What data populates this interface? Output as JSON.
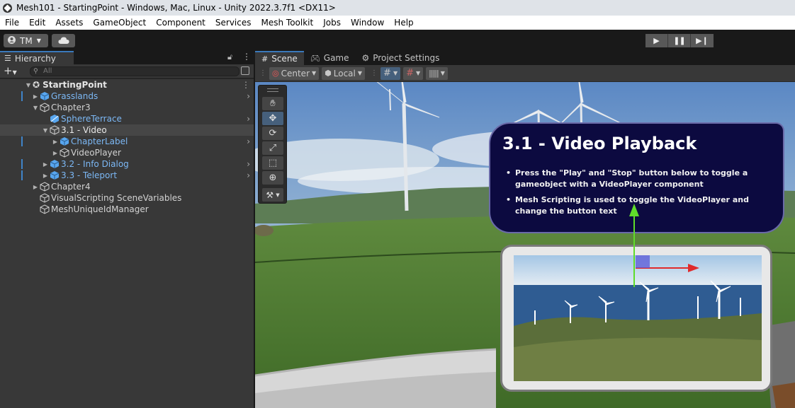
{
  "window": {
    "title": "Mesh101 - StartingPoint - Windows, Mac, Linux - Unity 2022.3.7f1 <DX11>"
  },
  "menu": [
    "File",
    "Edit",
    "Assets",
    "GameObject",
    "Component",
    "Services",
    "Mesh Toolkit",
    "Jobs",
    "Window",
    "Help"
  ],
  "toolbar": {
    "account": "TM",
    "play_icons": [
      "play-icon",
      "pause-icon",
      "step-icon"
    ]
  },
  "hierarchy": {
    "tab_label": "Hierarchy",
    "search_placeholder": "All",
    "rows": [
      {
        "label": "StartingPoint",
        "level": 0,
        "expanded": true,
        "scene": true
      },
      {
        "label": "Grasslands",
        "level": 1,
        "prefab": true,
        "collapsed": true
      },
      {
        "label": "Chapter3",
        "level": 1,
        "expanded": true
      },
      {
        "label": "SphereTerrace",
        "level": 2,
        "prefab": true
      },
      {
        "label": "3.1 - Video",
        "level": 2,
        "expanded": true,
        "selected": true
      },
      {
        "label": "ChapterLabel",
        "level": 3,
        "prefab": true,
        "collapsed": true
      },
      {
        "label": "VideoPlayer",
        "level": 3,
        "collapsed": true
      },
      {
        "label": "3.2 - Info Dialog",
        "level": 2,
        "prefab": true,
        "collapsed": true
      },
      {
        "label": "3.3 - Teleport",
        "level": 2,
        "prefab": true,
        "collapsed": true
      },
      {
        "label": "Chapter4",
        "level": 1,
        "collapsed": true
      },
      {
        "label": "VisualScripting SceneVariables",
        "level": 1
      },
      {
        "label": "MeshUniqueIdManager",
        "level": 1
      }
    ]
  },
  "scene_tabs": {
    "scene": "Scene",
    "game": "Game",
    "project_settings": "Project Settings"
  },
  "scene_tools": {
    "pivot": "Center",
    "space": "Local"
  },
  "info_panel": {
    "title": "3.1 - Video Playback",
    "bullets": [
      "Press the \"Play\" and \"Stop\" button below to toggle a gameobject with a VideoPlayer component",
      "Mesh Scripting is used to toggle the VideoPlayer and change the button text"
    ]
  },
  "colors": {
    "accent": "#3a79bb",
    "prefab_blue": "#7cb8f5",
    "panel_navy": "#0c0a40"
  }
}
